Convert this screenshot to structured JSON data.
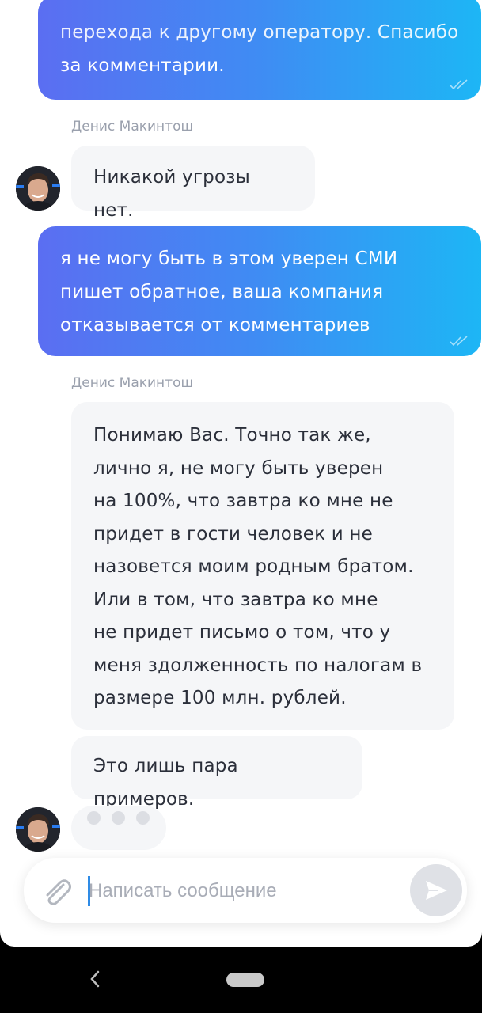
{
  "chat": {
    "messages": [
      {
        "type": "outgoing",
        "lines": [
          "перехода к другому оператору. Спасибо",
          "за комментарии."
        ]
      },
      {
        "type": "sender",
        "name": "Денис Макинтош"
      },
      {
        "type": "incoming",
        "text": "Никакой угрозы нет."
      },
      {
        "type": "outgoing",
        "lines": [
          "я не могу быть в этом уверен СМИ",
          "пишет обратное, ваша компания",
          "отказывается от комментариев"
        ]
      },
      {
        "type": "sender",
        "name": "Денис Макинтош"
      },
      {
        "type": "incoming",
        "lines": [
          "Понимаю Вас. Точно так же,",
          "лично я, не могу быть уверен",
          "на 100%, что завтра ко мне не",
          "придет в гости человек и не",
          "назовется моим родным братом.",
          "Или в том, что завтра ко мне",
          "не придет письмо о том, что у",
          "меня здолженность по налогам в",
          "размере 100 млн. рублей."
        ]
      },
      {
        "type": "incoming",
        "text": "Это лишь пара примеров."
      }
    ]
  },
  "composer": {
    "placeholder": "Написать сообщение",
    "value": ""
  },
  "icons": {
    "collapse": "chevron-down-icon",
    "read_status": "double-check-icon",
    "attach": "paperclip-icon",
    "send": "send-icon",
    "back": "back-icon"
  },
  "colors": {
    "outgoing_gradient_start": "#5b6ef2",
    "outgoing_gradient_end": "#1db6f5",
    "incoming_bg": "#f5f6f8",
    "caret": "#2e8be6"
  }
}
